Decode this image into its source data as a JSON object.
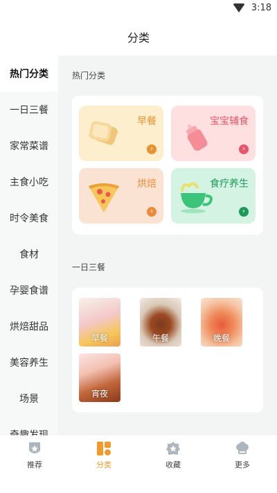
{
  "status": {
    "time": "3:18"
  },
  "header": {
    "title": "分类"
  },
  "sidebar": {
    "items": [
      {
        "label": "热门分类"
      },
      {
        "label": "一日三餐"
      },
      {
        "label": "家常菜谱"
      },
      {
        "label": "主食小吃"
      },
      {
        "label": "时令美食"
      },
      {
        "label": "食材"
      },
      {
        "label": "孕婴食谱"
      },
      {
        "label": "烘焙甜品"
      },
      {
        "label": "美容养生"
      },
      {
        "label": "场景"
      },
      {
        "label": "奇趣发现"
      }
    ]
  },
  "hot": {
    "title": "热门分类",
    "tiles": [
      {
        "label": "早餐",
        "icon": "toast-icon",
        "color": "#e7922f",
        "bg": "#fdeecd"
      },
      {
        "label": "宝宝辅食",
        "icon": "baby-bottle-icon",
        "color": "#e8556a",
        "bg": "#ffe0e0"
      },
      {
        "label": "烘焙",
        "icon": "pizza-icon",
        "color": "#ec8b3b",
        "bg": "#fbe3d3"
      },
      {
        "label": "食疗养生",
        "icon": "tea-cup-icon",
        "color": "#1c9a5a",
        "bg": "#d4f3e2"
      }
    ]
  },
  "meals": {
    "title": "一日三餐",
    "tiles": [
      {
        "label": "早餐"
      },
      {
        "label": "午餐"
      },
      {
        "label": "晚餐"
      },
      {
        "label": "宵夜"
      }
    ]
  },
  "tabbar": {
    "tabs": [
      {
        "label": "推荐",
        "icon": "shield-star-icon"
      },
      {
        "label": "分类",
        "icon": "category-grid-icon"
      },
      {
        "label": "收藏",
        "icon": "star-badge-icon"
      },
      {
        "label": "更多",
        "icon": "chef-hat-icon"
      }
    ],
    "active_color": "#f39a2e"
  }
}
